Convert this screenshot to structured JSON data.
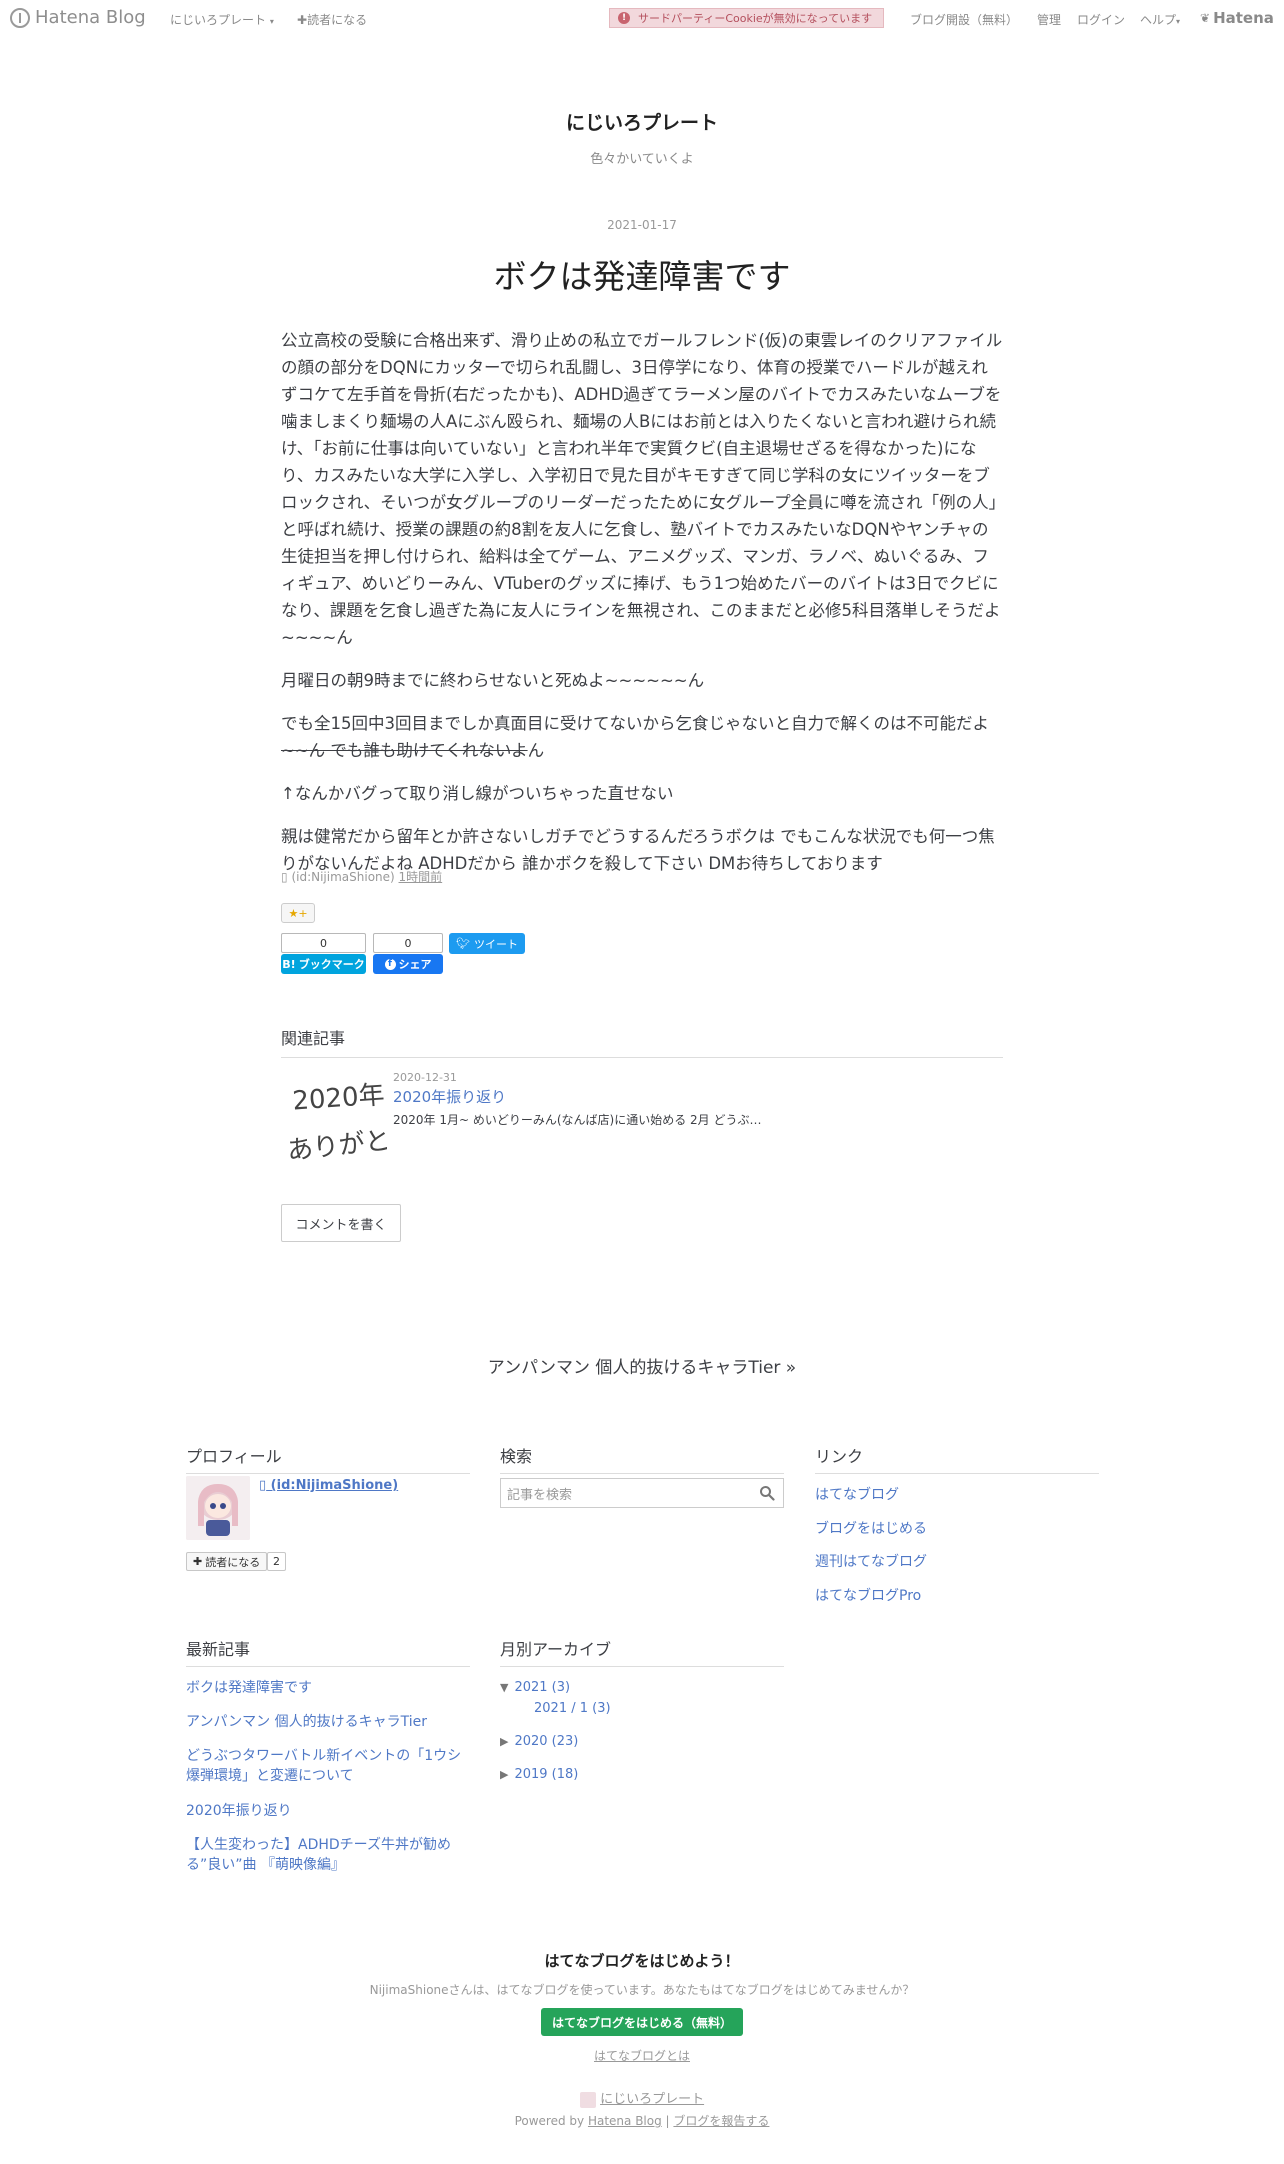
{
  "topbar": {
    "logo_text": "Hatena Blog",
    "blog_menu": "にじいろプレート",
    "subscribe": "読者になる",
    "cookie_alert": "サードパーティーCookieが無効になっています",
    "start_blog": "ブログ開設（無料）",
    "manage": "管理",
    "login": "ログイン",
    "help": "ヘルプ",
    "hatena_logo": "Hatena"
  },
  "blog": {
    "title": "にじいろプレート",
    "description": "色々かいていくよ"
  },
  "entry": {
    "date": "2021-01-17",
    "title": "ボクは発達障害です",
    "p1": "公立高校の受験に合格出来ず、滑り止めの私立でガールフレンド(仮)の東雲レイのクリアファイルの顔の部分をDQNにカッターで切られ乱闘し、3日停学になり、体育の授業でハードルが越えれずコケて左手首を骨折(右だったかも)、ADHD過ぎてラーメン屋のバイトでカスみたいなムーブを噛ましまくり麺場の人Aにぶん殴られ、麺場の人Bにはお前とは入りたくないと言われ避けられ続け、「お前に仕事は向いていない」と言われ半年で実質クビ(自主退場せざるを得なかった)になり、カスみたいな大学に入学し、入学初日で見た目がキモすぎて同じ学科の女にツイッターをブロックされ、そいつが女グループのリーダーだったために女グループ全員に噂を流され「例の人」と呼ばれ続け、授業の課題の約8割を友人に乞食し、塾バイトでカスみたいなDQNやヤンチャの生徒担当を押し付けられ、給料は全てゲーム、アニメグッズ、マンガ、ラノベ、ぬいぐるみ、フィギュア、めいどりーみん、VTuberのグッズに捧げ、もう1つ始めたバーのバイトは3日でクビになり、課題を乞食し過ぎた為に友人にラインを無視され、このままだと必修5科目落単しそうだよ~~~~ん",
    "p2": "月曜日の朝9時までに終わらせないと死ぬよ~~~~~~ん",
    "p3_plain": "でも全15回中3回目までしか真面目に受けてないから乞食じゃないと自力で解くのは不可能だよ",
    "p3_struck": "~~ん でも誰も助けてくれないよ",
    "p3_tail": "ん",
    "p4": "↑なんかバグって取り消し線がついちゃった直せない",
    "p5": "親は健常だから留年とか許さないしガチでどうするんだろうボクは でもこんな状況でも何一つ焦りがないんだよね ADHDだから 誰かボクを殺して下さい DMお待ちしております",
    "author_icon": "",
    "author": "(id:NijimaShione)",
    "time_ago": "1時間前",
    "star_label": "★+",
    "hatebu_count": "0",
    "hatebu_label": "ブックマーク",
    "fb_count": "0",
    "fb_label": "シェア",
    "tweet_label": "ツイート"
  },
  "related": {
    "heading": "関連記事",
    "thumb_line1": "2020年",
    "thumb_line2": "ありがとう",
    "date": "2020-12-31",
    "title": "2020年振り返り",
    "snippet": "2020年 1月~ めいどりーみん(なんば店)に通い始める 2月 どうぶ…"
  },
  "comment_button": "コメントを書く",
  "pager_next": "アンパンマン 個人的抜けるキャラTier »",
  "sidebar": {
    "profile": {
      "heading": "プロフィール",
      "id_text": " (id:NijimaShione)",
      "reader_label": "読者になる",
      "reader_count": "2"
    },
    "search": {
      "heading": "検索",
      "placeholder": "記事を検索"
    },
    "links": {
      "heading": "リンク",
      "items": [
        "はてなブログ",
        "ブログをはじめる",
        "週刊はてなブログ",
        "はてなブログPro"
      ]
    },
    "recent": {
      "heading": "最新記事",
      "items": [
        "ボクは発達障害です",
        "アンパンマン 個人的抜けるキャラTier",
        "どうぶつタワーバトル新イベントの「1ウシ爆弾環境」と変遷について",
        "2020年振り返り",
        "【人生変わった】ADHDチーズ牛丼が勧める”良い”曲 『萌映像編』"
      ]
    },
    "archive": {
      "heading": "月別アーカイブ",
      "y2021": "2021 (3)",
      "m2021_01": "2021 / 1 (3)",
      "y2020": "2020 (23)",
      "y2019": "2019 (18)"
    }
  },
  "footer": {
    "title": "はてなブログをはじめよう！",
    "desc": "NijimaShioneさんは、はてなブログを使っています。あなたもはてなブログをはじめてみませんか？",
    "start_button": "はてなブログをはじめる（無料）",
    "about_link": "はてなブログとは",
    "blog_name": "にじいろプレート",
    "powered_by": "Powered by",
    "powered_link": "Hatena Blog",
    "separator": "|",
    "report_link": "ブログを報告する"
  }
}
